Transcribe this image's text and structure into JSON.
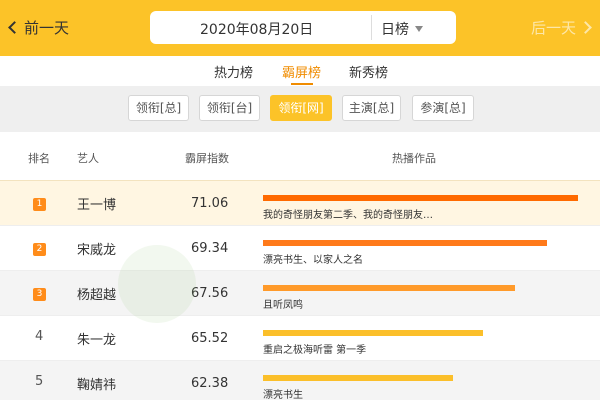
{
  "header": {
    "prev_label": "前一天",
    "date": "2020年08月20日",
    "period": "日榜",
    "next_label": "后一天"
  },
  "tabs": [
    {
      "label": "热力榜",
      "active": false
    },
    {
      "label": "霸屏榜",
      "active": true
    },
    {
      "label": "新秀榜",
      "active": false
    }
  ],
  "subtabs": [
    {
      "label": "领衔[总]",
      "active": false
    },
    {
      "label": "领衔[台]",
      "active": false
    },
    {
      "label": "领衔[网]",
      "active": true
    },
    {
      "label": "主演[总]",
      "active": false
    },
    {
      "label": "参演[总]",
      "active": false
    }
  ],
  "table": {
    "headers": {
      "rank": "排名",
      "artist": "艺人",
      "score": "霸屏指数",
      "works": "热播作品"
    },
    "rows": [
      {
        "rank": "1",
        "artist": "王一博",
        "score": "71.06",
        "works": "我的奇怪朋友第二季、我的奇怪朋友…",
        "bar": 1.0,
        "bar_color": "#ff6a00"
      },
      {
        "rank": "2",
        "artist": "宋威龙",
        "score": "69.34",
        "works": "漂亮书生、以家人之名",
        "bar": 0.902,
        "bar_color": "#ff7a1a"
      },
      {
        "rank": "3",
        "artist": "杨超越",
        "score": "67.56",
        "works": "且听凤鸣",
        "bar": 0.8,
        "bar_color": "#ff9a2a"
      },
      {
        "rank": "4",
        "artist": "朱一龙",
        "score": "65.52",
        "works": "重启之极海听雷 第一季",
        "bar": 0.698,
        "bar_color": "#fbbf2a"
      },
      {
        "rank": "5",
        "artist": "鞠婧祎",
        "score": "62.38",
        "works": "漂亮书生",
        "bar": 0.603,
        "bar_color": "#fbbf2a"
      }
    ]
  },
  "colors": {
    "accent": "#fcc328",
    "active_tab": "#f08c00",
    "badge": "#ff8c1a"
  }
}
